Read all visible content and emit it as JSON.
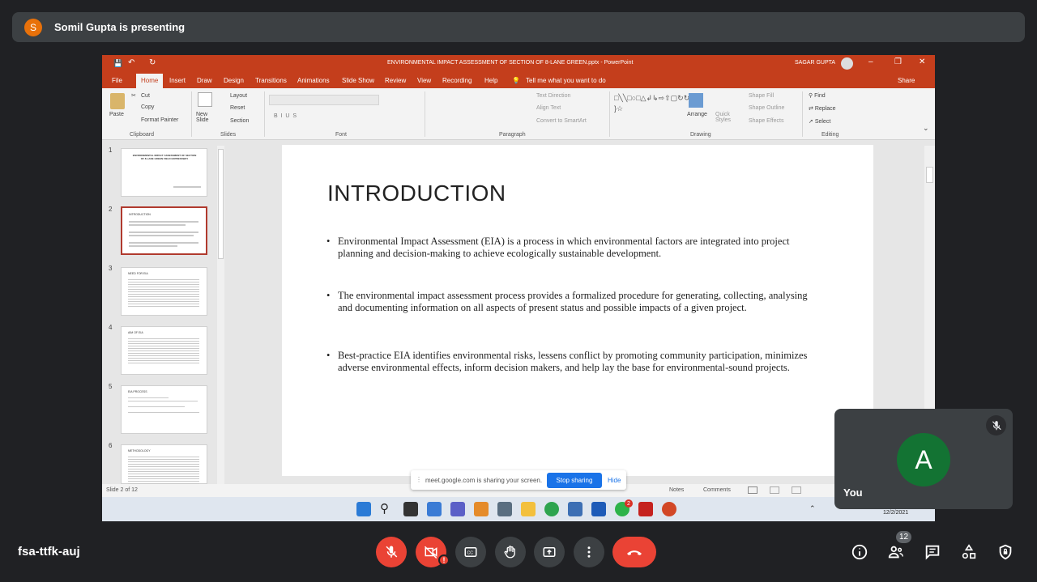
{
  "presenter": {
    "initial": "S",
    "text": "Somil Gupta is presenting"
  },
  "ppt": {
    "window_title": "ENVIRONMENTAL IMPACT ASSESSMENT OF SECTION OF 8-LANE GREEN.pptx - PowerPoint",
    "user": "SAGAR GUPTA",
    "tabs": [
      "File",
      "Home",
      "Insert",
      "Draw",
      "Design",
      "Transitions",
      "Animations",
      "Slide Show",
      "Review",
      "View",
      "Recording",
      "Help"
    ],
    "tell_me": "Tell me what you want to do",
    "share": "Share",
    "ribbon": {
      "paste": "Paste",
      "cut": "Cut",
      "copy": "Copy",
      "format_painter": "Format Painter",
      "new_slide": "New Slide",
      "layout": "Layout",
      "reset": "Reset",
      "section": "Section",
      "text_direction": "Text Direction",
      "align_text": "Align Text",
      "convert_smartart": "Convert to SmartArt",
      "arrange": "Arrange",
      "quick_styles": "Quick Styles",
      "shape_fill": "Shape Fill",
      "shape_outline": "Shape Outline",
      "shape_effects": "Shape Effects",
      "find": "Find",
      "replace": "Replace",
      "select": "Select",
      "groups": {
        "clipboard": "Clipboard",
        "slides": "Slides",
        "font": "Font",
        "paragraph": "Paragraph",
        "drawing": "Drawing",
        "editing": "Editing"
      }
    },
    "thumbs": [
      {
        "num": "1",
        "heading": "ENVIRONMENTAL IMPACT ASSESSMENT OF SECTION OF 8-LANE GREEN FIELD EXPRESSWAY"
      },
      {
        "num": "2",
        "heading": "INTRODUCTION"
      },
      {
        "num": "3",
        "heading": "NEED FOR EIA"
      },
      {
        "num": "4",
        "heading": "AIM OF EIA"
      },
      {
        "num": "5",
        "heading": "EIA PROCESS"
      },
      {
        "num": "6",
        "heading": "METHODOLOGY"
      }
    ],
    "slide": {
      "title": "INTRODUCTION",
      "bullets": [
        "Environmental Impact Assessment (EIA) is a process in which environmental factors are integrated into project planning and decision-making to achieve ecologically sustainable development.",
        "The environmental impact assessment process provides a formalized procedure for generating, collecting, analysing and documenting information on all aspects of present status and possible impacts of a given project.",
        "Best-practice EIA identifies environmental risks, lessens conflict by promoting community participation, minimizes adverse environmental effects, inform decision makers, and help lay the base for environmental-sound projects."
      ]
    },
    "status": {
      "slide_of": "Slide 2 of 12",
      "notes": "Notes",
      "comments": "Comments"
    },
    "taskbar": {
      "date": "12/2/2021",
      "badge": "2"
    }
  },
  "share_notice": {
    "text": "meet.google.com is sharing your screen.",
    "stop": "Stop sharing",
    "hide": "Hide"
  },
  "self": {
    "initial": "A",
    "name": "You"
  },
  "meeting": {
    "code": "fsa-ttfk-auj",
    "participants": "12"
  },
  "colors": {
    "bg": "#202124",
    "ppt_accent": "#c43e1c",
    "red": "#ea4335",
    "blue": "#1a73e8"
  }
}
